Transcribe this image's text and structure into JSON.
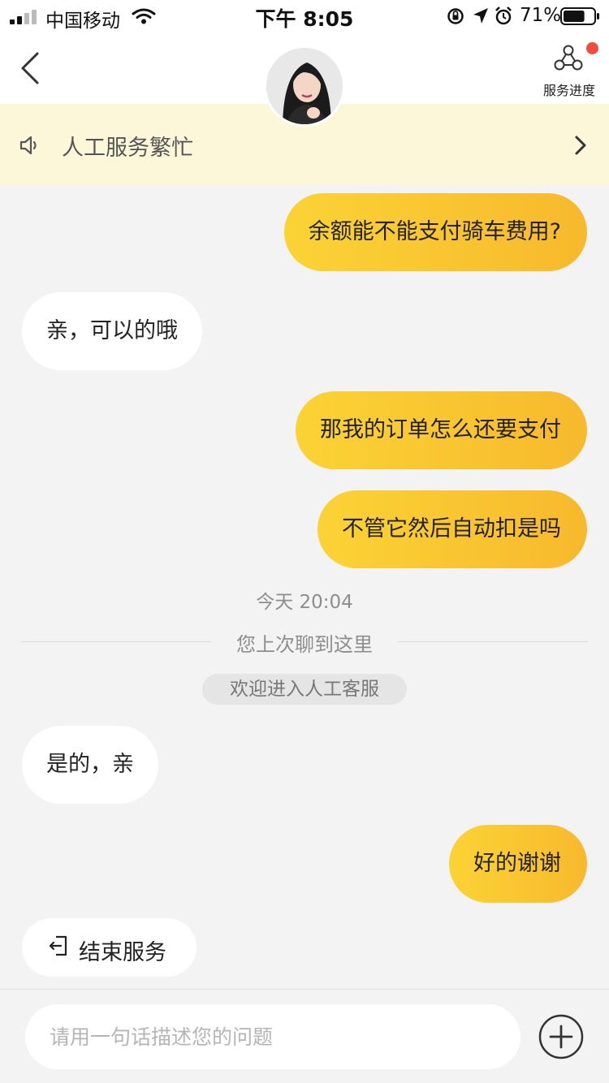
{
  "status_bar": {
    "carrier": "中国移动",
    "time": "下午 8:05",
    "battery_percent": "71%",
    "battery_level": 0.71
  },
  "nav": {
    "progress_label": "服务进度",
    "has_notification": true
  },
  "notice": {
    "text": "人工服务繁忙"
  },
  "messages": [
    {
      "from": "user",
      "text": "余额能不能支付骑车费用?"
    },
    {
      "from": "agent",
      "text": "亲，可以的哦"
    },
    {
      "from": "user",
      "text": "那我的订单怎么还要支付"
    },
    {
      "from": "user",
      "text": "不管它然后自动扣是吗"
    },
    {
      "from": "agent",
      "text": "是的，亲"
    },
    {
      "from": "user",
      "text": "好的谢谢"
    }
  ],
  "timestamp": "今天 20:04",
  "divider_text": "您上次聊到这里",
  "system_message": "欢迎进入人工客服",
  "end_service_label": "结束服务",
  "input": {
    "placeholder": "请用一句话描述您的问题",
    "value": ""
  },
  "colors": {
    "accent_start": "#fbd336",
    "accent_end": "#f7b92d",
    "notice_bg": "#fdf7da",
    "badge_red": "#f04a43"
  },
  "icons": {
    "back": "chevron-left-icon",
    "progress": "service-progress-icon",
    "speaker": "speaker-icon",
    "notice_arrow": "chevron-right-icon",
    "end": "exit-icon",
    "add": "plus-circle-icon"
  }
}
